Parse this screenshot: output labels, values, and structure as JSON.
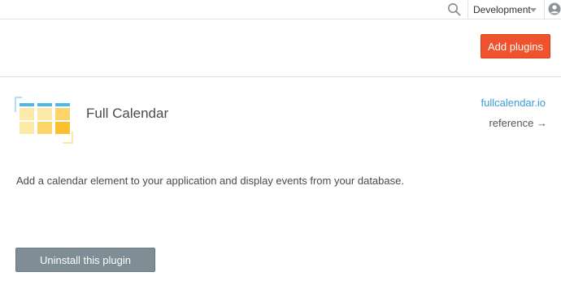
{
  "topbar": {
    "search_icon": "search-icon",
    "environment": {
      "selected": "Development",
      "chevron_icon": "chevron-down-icon"
    },
    "user_icon": "user-avatar-icon"
  },
  "header": {
    "add_plugins_label": "Add plugins"
  },
  "plugin": {
    "logo_icon": "calendar-grid-icon",
    "name": "Full Calendar",
    "site_link": "fullcalendar.io",
    "reference_label": "reference →",
    "description": "Add a calendar element to your application and display events from your database.",
    "uninstall_label": "Uninstall this plugin"
  },
  "colors": {
    "accent": "#f0522d",
    "link": "#3a9bd6",
    "uninstall": "#7f8e96",
    "logo_blue": "#4fb8e6",
    "logo_yellow": "#fbc02d"
  }
}
